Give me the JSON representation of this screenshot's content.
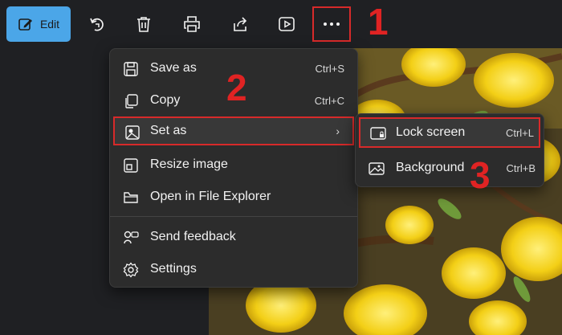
{
  "toolbar": {
    "edit_label": "Edit",
    "icons": [
      "edit-icon",
      "rotate-icon",
      "delete-icon",
      "print-icon",
      "share-icon",
      "slideshow-icon",
      "more-options-icon"
    ]
  },
  "menu": {
    "items": [
      {
        "label": "Save as",
        "shortcut": "Ctrl+S",
        "icon": "save-icon"
      },
      {
        "label": "Copy",
        "shortcut": "Ctrl+C",
        "icon": "copy-icon"
      },
      {
        "label": "Set as",
        "icon": "set-as-icon"
      },
      {
        "label": "Resize image",
        "icon": "resize-icon"
      },
      {
        "label": "Open in File Explorer",
        "icon": "folder-icon"
      },
      {
        "label": "Send feedback",
        "icon": "feedback-icon"
      },
      {
        "label": "Settings",
        "icon": "settings-icon"
      }
    ]
  },
  "submenu": {
    "items": [
      {
        "label": "Lock screen",
        "shortcut": "Ctrl+L",
        "icon": "lock-screen-icon"
      },
      {
        "label": "Background",
        "shortcut": "Ctrl+B",
        "icon": "background-icon"
      }
    ]
  },
  "annotations": {
    "step1": "1",
    "step2": "2",
    "step3": "3",
    "color": "#e02323"
  },
  "colors": {
    "accent": "#4ba6e8",
    "highlight_border": "#d72a2a",
    "menu_bg": "#2c2c2c",
    "app_bg": "#1f2023"
  }
}
